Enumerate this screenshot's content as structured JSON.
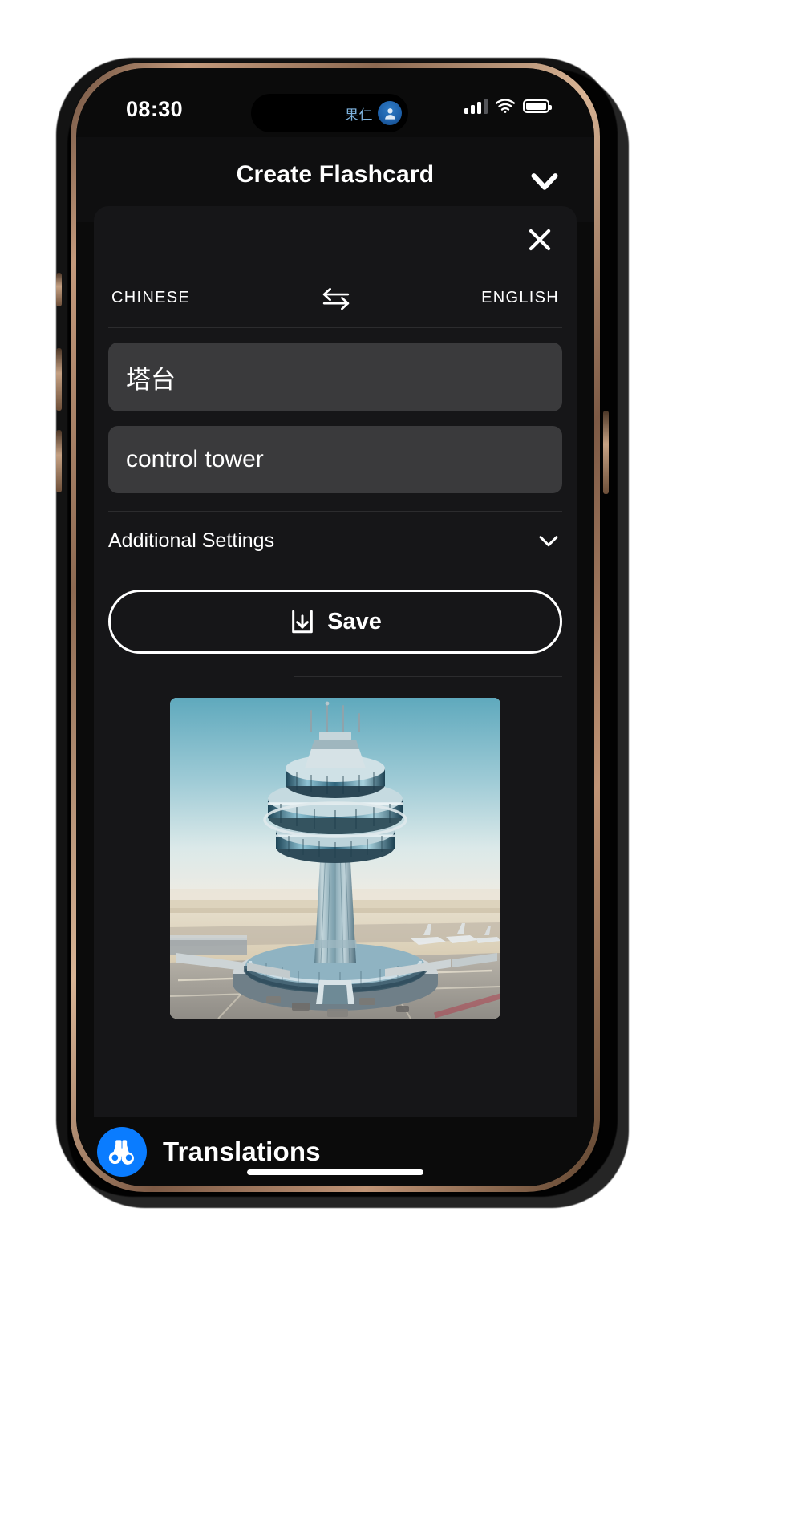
{
  "statusbar": {
    "time": "08:30",
    "dynamic_island": {
      "text": "果仁",
      "avatar_icon": "person-circle-icon"
    },
    "icons": {
      "signal": "cellular-signal-icon",
      "wifi": "wifi-icon",
      "battery": "battery-full-icon"
    }
  },
  "navbar": {
    "title": "Create Flashcard",
    "dismiss_icon": "chevron-down-icon"
  },
  "sheet": {
    "close_icon": "close-x-icon",
    "language_row": {
      "source_label": "CHINESE",
      "swap_icon": "swap-horizontal-arrows-icon",
      "target_label": "ENGLISH"
    },
    "source_field": {
      "value": "塔台",
      "placeholder": "塔台"
    },
    "target_field": {
      "value": "control tower",
      "placeholder": "control tower"
    },
    "additional_settings": {
      "label": "Additional Settings",
      "chevron_icon": "chevron-down-icon"
    },
    "save_button": {
      "label": "Save",
      "icon": "save-download-icon"
    },
    "illustration": {
      "alt": "airport control tower with terminal and parked airplanes"
    }
  },
  "app_bar": {
    "app_name": "Translations",
    "app_icon": "binoculars-icon"
  },
  "colors": {
    "accent": "#0a7cff",
    "sheet_bg": "#161618",
    "field_bg": "#3a3a3c",
    "screen_bg": "#0b0b0b",
    "text_primary": "#ffffff",
    "divider": "#2c2c2e",
    "island_text": "#7fb4e0"
  }
}
